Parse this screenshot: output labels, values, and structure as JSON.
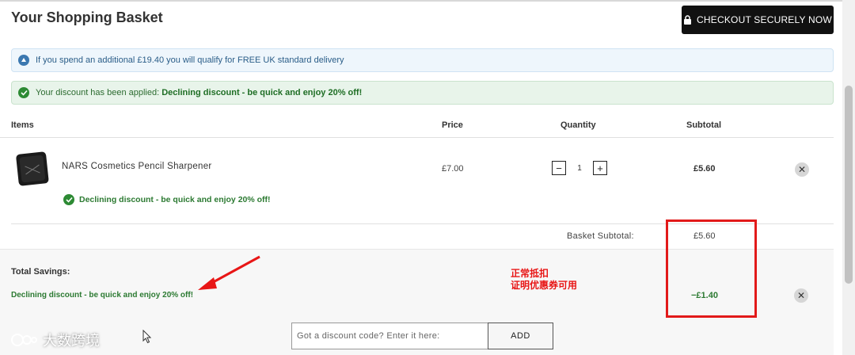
{
  "header": {
    "title": "Your Shopping Basket",
    "checkout_label": "CHECKOUT SECURELY NOW"
  },
  "alerts": {
    "info": "If you spend an additional £19.40 you will qualify for FREE UK standard delivery",
    "success_prefix": "Your discount has been applied:",
    "success_discount": "Declining discount - be quick and enjoy 20% off!"
  },
  "table": {
    "headers": [
      "Items",
      "Price",
      "Quantity",
      "Subtotal"
    ],
    "rows": [
      {
        "name": "NARS Cosmetics Pencil Sharpener",
        "price": "£7.00",
        "quantity": "1",
        "subtotal": "£5.60",
        "discount": "Declining discount - be quick and enjoy 20% off!"
      }
    ]
  },
  "basket": {
    "subtotal_label": "Basket Subtotal:",
    "subtotal_value": "£5.60"
  },
  "savings": {
    "title": "Total Savings:",
    "discount_name": "Declining discount - be quick and enjoy 20% off!",
    "amount": "−£1.40"
  },
  "discount_code": {
    "placeholder": "Got a discount code? Enter it here:",
    "button_label": "ADD"
  },
  "annotation": {
    "line1": "正常抵扣",
    "line2": "证明优惠券可用"
  },
  "watermark": {
    "text": "大数跨境"
  },
  "colors": {
    "checkout_bg": "#111111",
    "success_green": "#2c7a32",
    "info_blue": "#2a5d88",
    "annotation_red": "#e21a1a"
  }
}
